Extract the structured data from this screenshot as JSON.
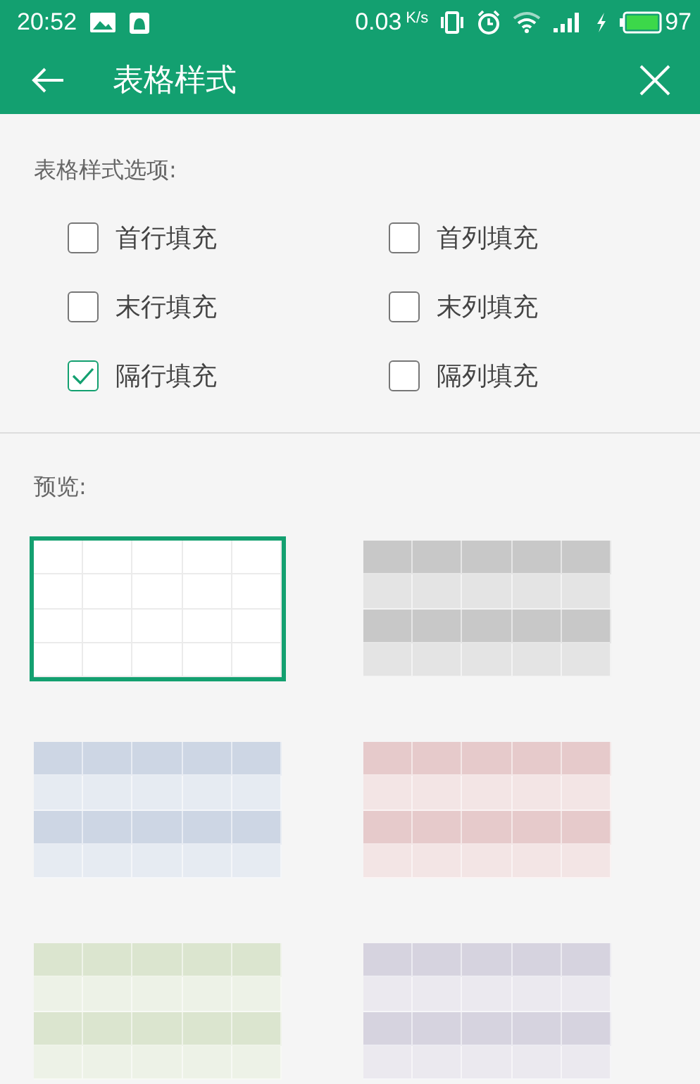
{
  "status_bar": {
    "time": "20:52",
    "speed": "0.03",
    "speed_unit": "K/s",
    "battery": "97"
  },
  "toolbar": {
    "title": "表格样式"
  },
  "options": {
    "label": "表格样式选项:",
    "items": [
      {
        "label": "首行填充",
        "checked": false
      },
      {
        "label": "首列填充",
        "checked": false
      },
      {
        "label": "末行填充",
        "checked": false
      },
      {
        "label": "末列填充",
        "checked": false
      },
      {
        "label": "隔行填充",
        "checked": true
      },
      {
        "label": "隔列填充",
        "checked": false
      }
    ]
  },
  "preview": {
    "label": "预览:",
    "styles": [
      {
        "kind": "plain",
        "color": "#ffffff",
        "selected": true
      },
      {
        "kind": "banded",
        "color": "#c8c8c8",
        "selected": false
      },
      {
        "kind": "banded",
        "color": "#cdd6e4",
        "selected": false
      },
      {
        "kind": "banded",
        "color": "#e6cacb",
        "selected": false
      },
      {
        "kind": "banded",
        "color": "#dbe5cf",
        "selected": false
      },
      {
        "kind": "banded",
        "color": "#d6d3df",
        "selected": false
      }
    ]
  }
}
